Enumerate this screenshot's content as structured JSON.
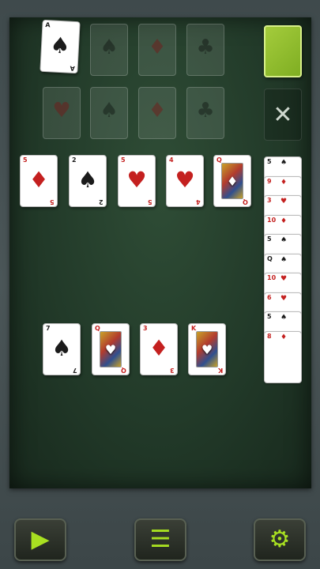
{
  "foundations_top": [
    {
      "rank": "A",
      "suit": "♠",
      "color": "blk",
      "face_up": true
    },
    {
      "rank": "",
      "suit": "♠",
      "color": "blk",
      "face_up": false
    },
    {
      "rank": "",
      "suit": "♦",
      "color": "red",
      "face_up": false
    },
    {
      "rank": "",
      "suit": "♣",
      "color": "blk",
      "face_up": false
    }
  ],
  "foundations_bottom": [
    {
      "suit": "♥",
      "color": "red"
    },
    {
      "suit": "♠",
      "color": "blk"
    },
    {
      "suit": "♦",
      "color": "red"
    },
    {
      "suit": "♣",
      "color": "blk"
    }
  ],
  "tableau_row1": [
    {
      "rank": "5",
      "suit": "♦",
      "color": "red"
    },
    {
      "rank": "2",
      "suit": "♠",
      "color": "blk"
    },
    {
      "rank": "5",
      "suit": "♥",
      "color": "red"
    },
    {
      "rank": "4",
      "suit": "♥",
      "color": "red"
    },
    {
      "rank": "Q",
      "suit": "♦",
      "color": "red",
      "face": true
    }
  ],
  "tableau_row2": [
    {
      "rank": "7",
      "suit": "♠",
      "color": "blk"
    },
    {
      "rank": "Q",
      "suit": "♥",
      "color": "red",
      "face": true
    },
    {
      "rank": "3",
      "suit": "♦",
      "color": "red"
    },
    {
      "rank": "K",
      "suit": "♥",
      "color": "red",
      "face": true
    }
  ],
  "waste_strip": [
    {
      "rank": "5",
      "suit": "♠",
      "color": "blk"
    },
    {
      "rank": "9",
      "suit": "♦",
      "color": "red"
    },
    {
      "rank": "3",
      "suit": "♥",
      "color": "red"
    },
    {
      "rank": "10",
      "suit": "♦",
      "color": "red"
    },
    {
      "rank": "5",
      "suit": "♠",
      "color": "blk"
    },
    {
      "rank": "Q",
      "suit": "♠",
      "color": "blk"
    },
    {
      "rank": "10",
      "suit": "♥",
      "color": "red"
    },
    {
      "rank": "6",
      "suit": "♥",
      "color": "red"
    },
    {
      "rank": "5",
      "suit": "♠",
      "color": "blk"
    },
    {
      "rank": "8",
      "suit": "♦",
      "color": "red"
    }
  ],
  "stock": {
    "color": "#8fbe2b"
  },
  "discard_symbol": "✕",
  "toolbar": {
    "play_symbol": "▶",
    "menu_symbol": "☰",
    "settings_symbol": "⚙"
  },
  "colors": {
    "felt": "#223a29",
    "accent": "#a8e021"
  }
}
